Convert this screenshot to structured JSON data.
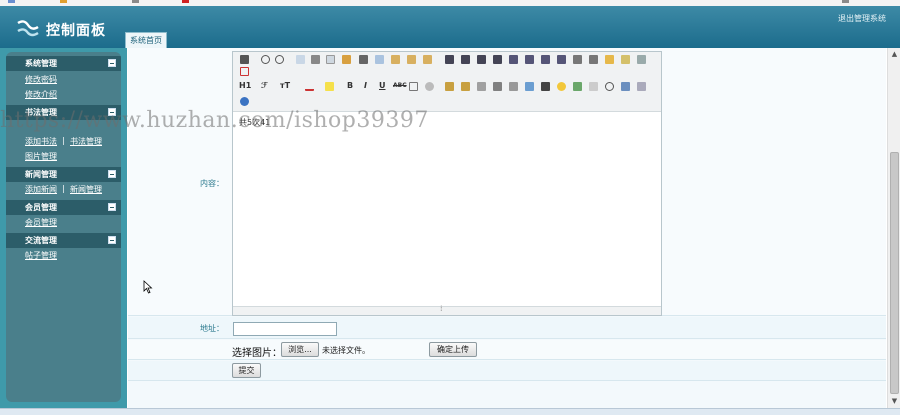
{
  "header": {
    "title": "控制面板",
    "logout": "退出管理系统",
    "tab_home": "系统首页"
  },
  "sidebar": {
    "sections": [
      {
        "label": "系统管理",
        "links": [
          "修改密码",
          "修改介绍"
        ]
      },
      {
        "label": "书法管理",
        "links": [
          "添加书法",
          "书法管理",
          "图片管理"
        ]
      },
      {
        "label": "新闻管理",
        "links": [
          "添加新闻",
          "新闻管理"
        ]
      },
      {
        "label": "会员管理",
        "links": [
          "会员管理"
        ]
      },
      {
        "label": "交流管理",
        "links": [
          "帖子管理"
        ]
      }
    ],
    "separator": "|"
  },
  "form": {
    "content_label": "内容：",
    "editor_text": "共5次41",
    "address_label": "地址：",
    "address_value": "",
    "choose_image_label": "选择图片：",
    "browse_button": "浏览...",
    "no_file": "未选择文件。",
    "upload_button": "确定上传",
    "submit_button": "提交"
  },
  "editor_toolbar": {
    "heading_label": "H1",
    "font_family_label": "ℱ",
    "font_size_label": "тT",
    "bold_label": "B",
    "italic_label": "I",
    "underline_label": "U",
    "strike_label": "ABC"
  },
  "watermark": "https://www.huzhan.com/ishop39397",
  "colors": {
    "header": "#1c6c8c",
    "sidebar_panel": "#4a7f8b",
    "section_header": "#2c5d69",
    "label_text": "#2d7b8f"
  }
}
